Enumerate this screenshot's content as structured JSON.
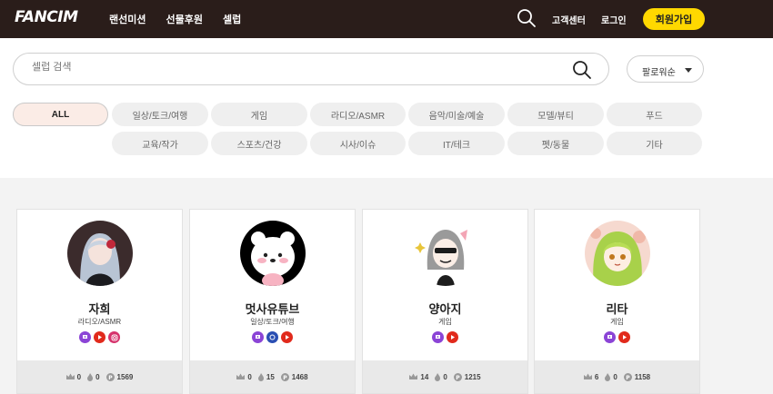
{
  "brand": {
    "logo": "FANCIM",
    "accent": "#ffd800",
    "nav_bg": "#2a1d1a"
  },
  "nav": {
    "menu": [
      "랜선미션",
      "선물후원",
      "셀럽"
    ],
    "support": "고객센터",
    "login": "로그인",
    "join": "회원가입"
  },
  "search": {
    "placeholder": "셀럽 검색",
    "value": ""
  },
  "sort": {
    "selected": "팔로워순"
  },
  "categories": {
    "row1": [
      "ALL",
      "일상/토크/여행",
      "게임",
      "라디오/ASMR",
      "음악/미술/예술",
      "모델/뷰티",
      "푸드"
    ],
    "row2": [
      "교육/작가",
      "스포츠/건강",
      "시사/이슈",
      "IT/테크",
      "펫/동물",
      "기타"
    ],
    "active": "ALL"
  },
  "celebs": [
    {
      "name": "자희",
      "category": "라디오/ASMR",
      "socials": [
        "twitch-icon",
        "youtube-icon",
        "instagram-icon"
      ],
      "stat1": "0",
      "stat2": "0",
      "points": "1569"
    },
    {
      "name": "멋사유튜브",
      "category": "일상/토크/여행",
      "socials": [
        "twitch-icon",
        "afreeca-icon",
        "youtube-icon"
      ],
      "stat1": "0",
      "stat2": "15",
      "points": "1468"
    },
    {
      "name": "양아지",
      "category": "게임",
      "socials": [
        "twitch-icon",
        "youtube-icon"
      ],
      "stat1": "14",
      "stat2": "0",
      "points": "1215"
    },
    {
      "name": "리타",
      "category": "게임",
      "socials": [
        "twitch-icon",
        "youtube-icon"
      ],
      "stat1": "6",
      "stat2": "0",
      "points": "1158"
    }
  ]
}
